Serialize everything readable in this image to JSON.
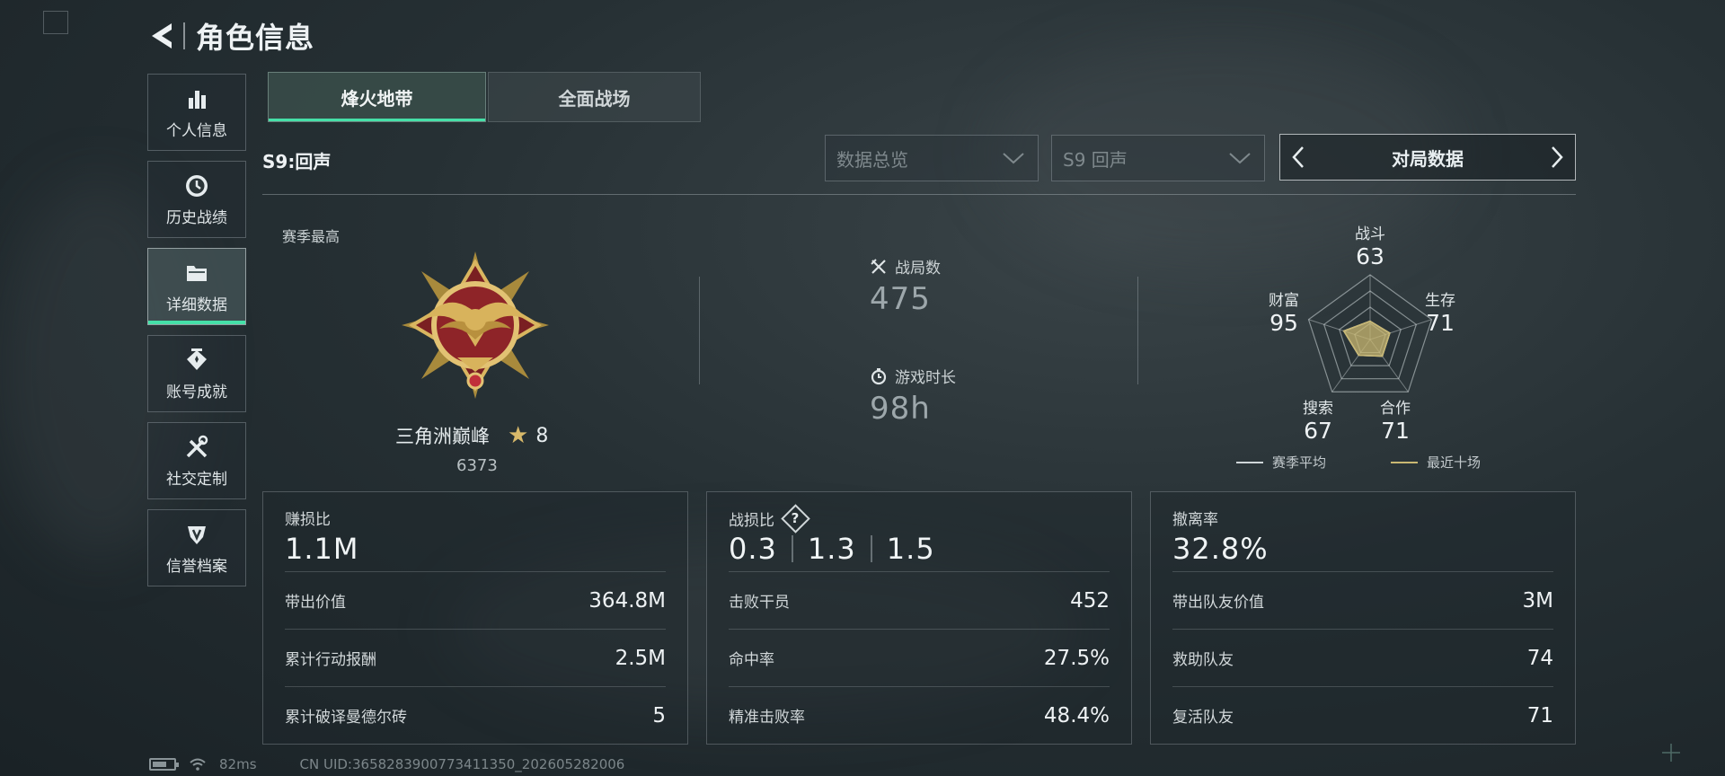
{
  "header": {
    "title": "角色信息",
    "back_icon": "back-arrow-icon"
  },
  "sidebar": {
    "items": [
      {
        "label": "个人信息",
        "icon": "bar-chart-icon",
        "active": false
      },
      {
        "label": "历史战绩",
        "icon": "clock-icon",
        "active": false
      },
      {
        "label": "详细数据",
        "icon": "folder-icon",
        "active": true
      },
      {
        "label": "账号成就",
        "icon": "trophy-icon",
        "active": false
      },
      {
        "label": "社交定制",
        "icon": "tools-icon",
        "active": false
      },
      {
        "label": "信誉档案",
        "icon": "shield-icon",
        "active": false
      }
    ]
  },
  "tabs": [
    {
      "label": "烽火地带",
      "active": true
    },
    {
      "label": "全面战场",
      "active": false
    }
  ],
  "filters": {
    "season": "S9:回声",
    "dropdown_overview": "数据总览",
    "dropdown_season": "S9 回声",
    "pager_label": "对局数据"
  },
  "season_best": {
    "label": "赛季最高",
    "rank_name": "三角洲巅峰",
    "stars": "8",
    "score": "6373"
  },
  "summary": {
    "matches_label": "战局数",
    "matches_value": "475",
    "playtime_label": "游戏时长",
    "playtime_value": "98h"
  },
  "radar": {
    "axes": [
      {
        "name": "战斗",
        "value": "63"
      },
      {
        "name": "生存",
        "value": "71"
      },
      {
        "name": "合作",
        "value": "71"
      },
      {
        "name": "搜索",
        "value": "67"
      },
      {
        "name": "财富",
        "value": "95"
      }
    ],
    "legend_season_avg": "赛季平均",
    "legend_recent": "最近十场",
    "season_avg_color": "#cfd6d8",
    "recent_color": "#c9b872"
  },
  "cards": {
    "profit": {
      "title": "赚损比",
      "value": "1.1M",
      "rows": [
        {
          "label": "带出价值",
          "value": "364.8M"
        },
        {
          "label": "累计行动报酬",
          "value": "2.5M"
        },
        {
          "label": "累计破译曼德尔砖",
          "value": "5"
        }
      ]
    },
    "kd": {
      "title": "战损比",
      "help": "?",
      "values": [
        "0.3",
        "1.3",
        "1.5"
      ],
      "rows": [
        {
          "label": "击败干员",
          "value": "452"
        },
        {
          "label": "命中率",
          "value": "27.5%"
        },
        {
          "label": "精准击败率",
          "value": "48.4%"
        }
      ]
    },
    "extract": {
      "title": "撤离率",
      "value": "32.8%",
      "rows": [
        {
          "label": "带出队友价值",
          "value": "3M"
        },
        {
          "label": "救助队友",
          "value": "74"
        },
        {
          "label": "复活队友",
          "value": "71"
        }
      ]
    }
  },
  "footer": {
    "ping": "82ms",
    "uid": "CN UID:3658283900773411350_202605282006"
  },
  "colors": {
    "accent": "#45e0a8"
  }
}
